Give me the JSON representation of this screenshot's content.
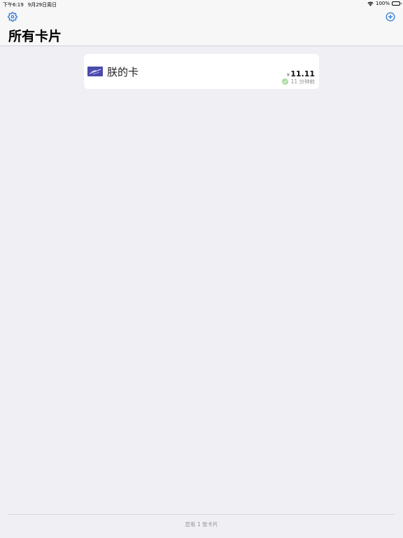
{
  "status_bar": {
    "time": "下午6:19",
    "date": "9月29日周日",
    "battery": "100%"
  },
  "nav": {
    "title": "所有卡片",
    "settings_icon": "gear-icon",
    "add_icon": "plus-circle-icon",
    "accent_color": "#1f6fd1"
  },
  "cards": [
    {
      "name": "朕的卡",
      "currency": "¥",
      "amount": "11.11",
      "sync_status": "11 分钟前",
      "sync_icon": "check-circle-icon",
      "sync_color": "#a8dca0"
    }
  ],
  "footer": {
    "count_text": "您有 1 张卡片"
  }
}
